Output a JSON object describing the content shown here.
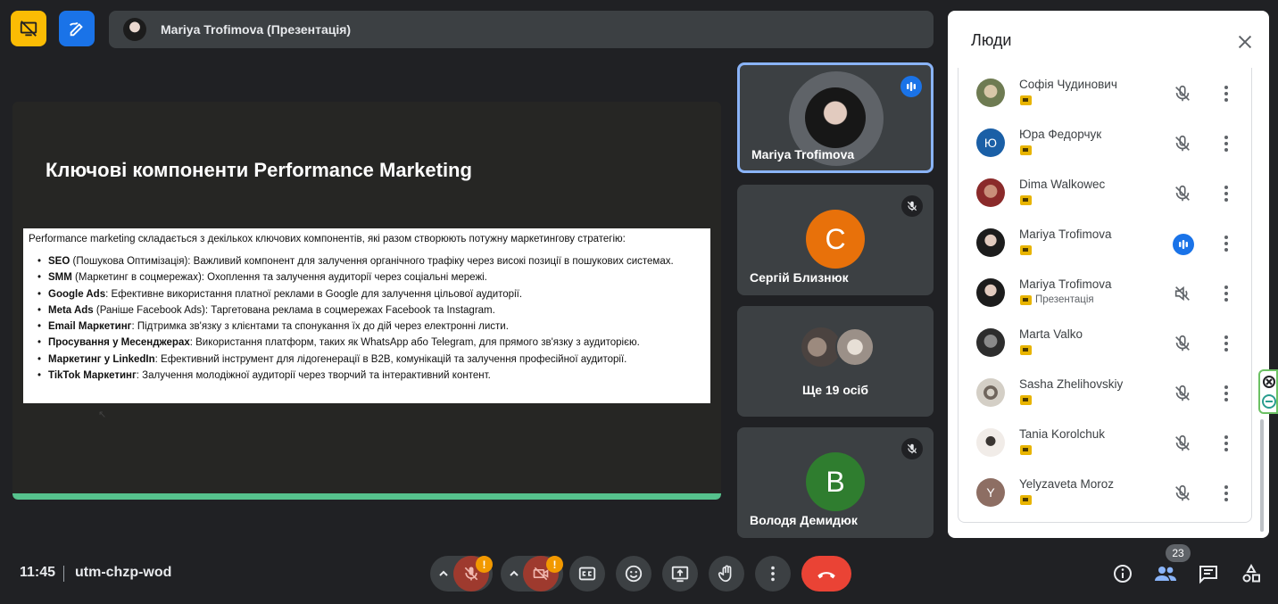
{
  "header": {
    "presenter_label": "Mariya Trofimova (Презентація)"
  },
  "slide": {
    "title": "Ключові компоненти Performance Marketing",
    "intro": "Performance marketing складається з декількох ключових компонентів, які разом створюють потужну маркетингову стратегію:",
    "items": [
      {
        "bold": "SEO",
        "text": " (Пошукова Оптимізація): Важливий компонент для залучення органічного трафіку через високі позиції в пошукових системах."
      },
      {
        "bold": "SMM",
        "text": " (Маркетинг в соцмережах): Охоплення та залучення аудиторії через соціальні мережі."
      },
      {
        "bold": "Google Ads",
        "text": ": Ефективне використання платної реклами в Google для залучення цільової аудиторії."
      },
      {
        "bold": "Meta Ads",
        "text": " (Раніше Facebook Ads): Таргетована реклама в соцмережах Facebook та Instagram."
      },
      {
        "bold": "Email Маркетинг",
        "text": ": Підтримка зв'язку з клієнтами та спонукання їх до дій через електронні листи."
      },
      {
        "bold": "Просування у Месенджерах",
        "text": ": Використання платформ, таких як WhatsApp або Telegram, для прямого зв'язку з аудиторією."
      },
      {
        "bold": "Маркетинг у LinkedIn",
        "text": ": Ефективний інструмент для лідогенерації в B2B, комунікацій та залучення професійної аудиторії."
      },
      {
        "bold": "TikTok Маркетинг",
        "text": ": Залучення молодіжної аудиторії через творчий та інтерактивний контент."
      }
    ]
  },
  "tiles": [
    {
      "name": "Mariya Trofimova"
    },
    {
      "name": "Сергій Близнюк",
      "initial": "C"
    },
    {
      "name": "Ще 19 осіб"
    },
    {
      "name": "Володя Демидюк",
      "initial": "B"
    }
  ],
  "people_panel": {
    "title": "Люди",
    "participants": [
      {
        "name": "Софія Чудинович",
        "status": "muted"
      },
      {
        "name": "Юра Федорчук",
        "initial": "Ю",
        "status": "muted"
      },
      {
        "name": "Dima Walkowec",
        "status": "muted"
      },
      {
        "name": "Mariya Trofimova",
        "status": "speaking"
      },
      {
        "name": "Mariya Trofimova",
        "sub": "Презентація",
        "status": "audio-off"
      },
      {
        "name": "Marta Valko",
        "status": "muted"
      },
      {
        "name": "Sasha Zhelihovskiy",
        "status": "muted"
      },
      {
        "name": "Tania Korolchuk",
        "status": "muted"
      },
      {
        "name": "Yelyzaveta Moroz",
        "initial": "Y",
        "status": "muted"
      }
    ]
  },
  "footer": {
    "time": "11:45",
    "meeting_code": "utm-chzp-wod",
    "people_count": "23",
    "warn_mark": "!"
  },
  "colors": {
    "accent_blue": "#1a73e8",
    "hangup_red": "#ea4335",
    "warning_orange": "#f29900",
    "avatar_orange": "#e8710a",
    "avatar_green": "#2f7d2f"
  }
}
